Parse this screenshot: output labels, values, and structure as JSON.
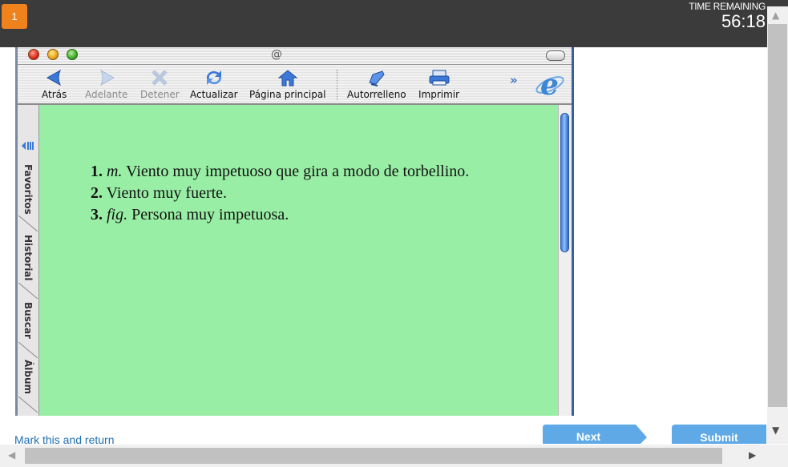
{
  "header": {
    "question_number": "1",
    "time_label": "TIME REMAINING",
    "time_value": "56:18"
  },
  "browser": {
    "address_symbol": "@",
    "toolbar": [
      {
        "label": "Atrás",
        "icon": "back-arrow-icon",
        "enabled": true
      },
      {
        "label": "Adelante",
        "icon": "forward-arrow-icon",
        "enabled": false
      },
      {
        "label": "Detener",
        "icon": "stop-icon",
        "enabled": false
      },
      {
        "label": "Actualizar",
        "icon": "refresh-icon",
        "enabled": true
      },
      {
        "label": "Página principal",
        "icon": "home-icon",
        "enabled": true
      },
      {
        "label": "Autorrelleno",
        "icon": "autofill-icon",
        "enabled": true
      },
      {
        "label": "Imprimir",
        "icon": "print-icon",
        "enabled": true
      }
    ],
    "more_symbol": "»",
    "sidebar_tabs": [
      "Favoritos",
      "Historial",
      "Buscar",
      "Álbum"
    ],
    "content_bg": "#99eea5"
  },
  "definitions": [
    {
      "num": "1.",
      "abbr": "m.",
      "text": " Viento muy impetuoso que gira a modo de torbellino."
    },
    {
      "num": "2.",
      "abbr": "",
      "text": " Viento muy fuerte."
    },
    {
      "num": "3.",
      "abbr": "fig.",
      "text": " Persona muy impetuosa."
    }
  ],
  "footer": {
    "mark_link": "Mark this and return",
    "next_label": "Next",
    "submit_label": "Submit"
  },
  "colors": {
    "accent": "#f0821e",
    "button": "#5fa9e6",
    "link": "#1f6fb2"
  }
}
